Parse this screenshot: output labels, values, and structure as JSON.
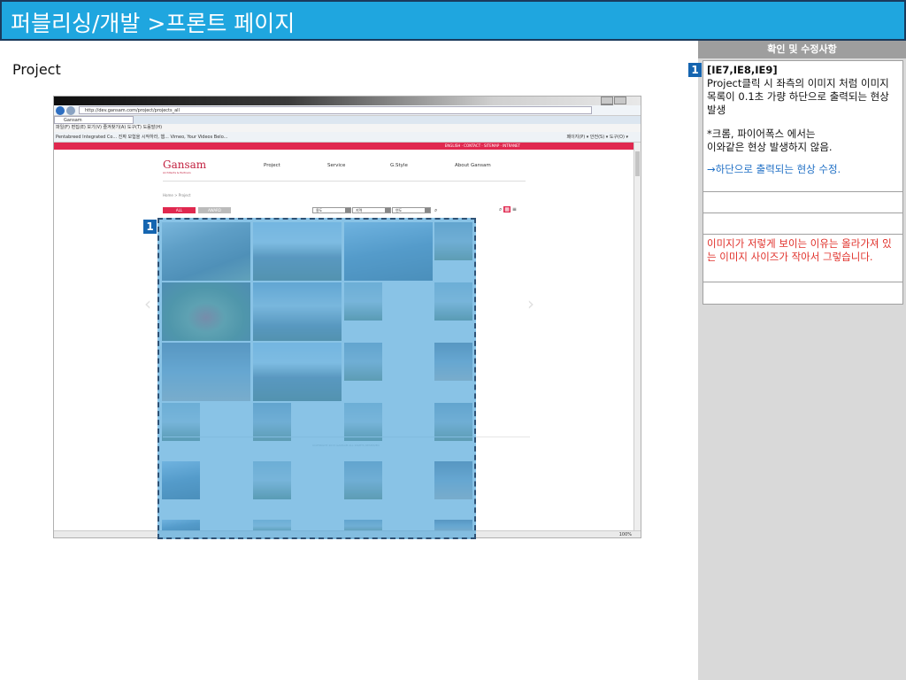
{
  "header": {
    "title": "퍼블리싱/개발 >프론트 페이지"
  },
  "section_label": "Project",
  "panel": {
    "title": "확인 및 수정사항"
  },
  "badge_number": "1",
  "notes": {
    "row1": {
      "title": "[IE7,IE8,IE9]",
      "line1": "Project클릭 시 좌측의 이미지 처럼 이미지 목록이 0.1초 가량 하단으로 출력되는 현상 발생",
      "line2": "*크롬, 파이어폭스 에서는",
      "line3": "이와같은 현상 발생하지 않음.",
      "fix": "→하단으로 출력되는 현상 수정."
    },
    "row4": "이미지가 저렇게 보이는 이유는 올라가져 있는 이미지 사이즈가 작아서 그렇습니다."
  },
  "browser": {
    "url": "http://dev.gansam.com/project/projects_all",
    "tab": "Gansam",
    "menu": "파일(F)  편집(E)  보기(V)  즐겨찾기(A)  도구(T)  도움말(H)",
    "favorites": "Pentabreed Integrated Co...   진짜 모험을 시작하라, 햄...   Vimeo, Your Videos Belo...",
    "favorites_right": "페이지(P) ▾  안전(S) ▾  도구(O) ▾",
    "topstrip": "ENGLISH · CONTACT · SITEMAP · INTRANET",
    "zoom": "100%",
    "site": {
      "logo": "Gansam",
      "logo_sub": "Architects & Partners",
      "nav": [
        "Project",
        "Service",
        "G.Style",
        "About Gansam"
      ],
      "breadcrumb": "Home > Project",
      "btn_all": "ALL",
      "btn_award": "AWARD",
      "filters": [
        "용도",
        "지역",
        "연도"
      ],
      "copyright": "COPYRIGHT 2013 GANSAM ALL RIGHTS RESERVED"
    }
  }
}
